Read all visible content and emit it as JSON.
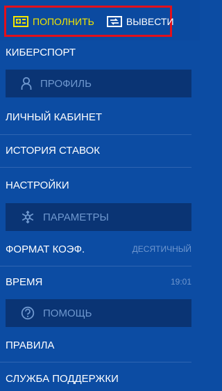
{
  "top_actions": {
    "deposit_label": "ПОПОЛНИТЬ",
    "withdraw_label": "ВЫВЕСТИ"
  },
  "menu": {
    "esports": "КИБЕРСПОРТ",
    "profile_section": "ПРОФИЛЬ",
    "personal_cabinet": "ЛИЧНЫЙ КАБИНЕТ",
    "bet_history": "ИСТОРИЯ СТАВОК",
    "settings": "НАСТРОЙКИ",
    "parameters_section": "ПАРАМЕТРЫ",
    "odds_format_label": "ФОРМАТ КОЭФ.",
    "odds_format_value": "ДЕСЯТИЧНЫЙ",
    "time_label": "ВРЕМЯ",
    "time_value": "19:01",
    "help_section": "ПОМОЩЬ",
    "rules": "ПРАВИЛА",
    "support": "СЛУЖБА ПОДДЕРЖКИ"
  },
  "colors": {
    "background": "#0c4ca3",
    "section_bg": "#0a3474",
    "deposit_accent": "#f2e600",
    "highlight_border": "#e3101b",
    "muted_text": "#6f97cf"
  },
  "icons": {
    "deposit": "wallet-plus-icon",
    "withdraw": "wallet-transfer-icon",
    "profile": "user-icon",
    "parameters": "snowflake-gear-icon",
    "help": "question-circle-icon"
  }
}
